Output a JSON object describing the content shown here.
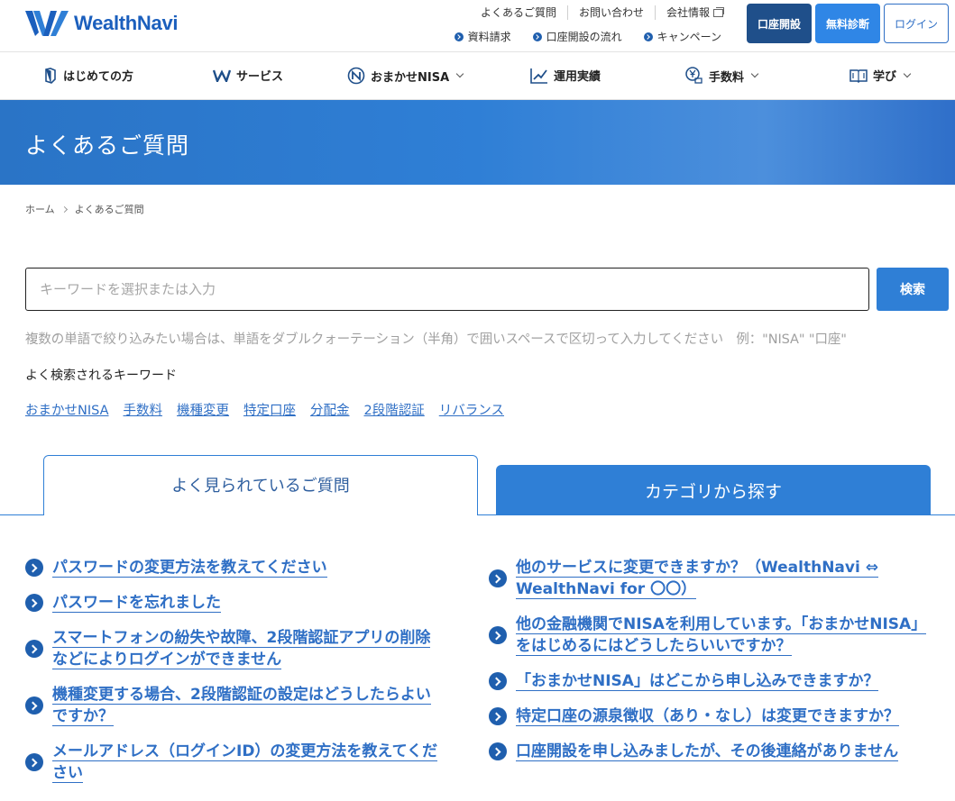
{
  "header": {
    "logo_text": "WealthNavi",
    "util_links": [
      "よくあるご質問",
      "お問い合わせ",
      "会社情報"
    ],
    "util_links2": [
      "資料請求",
      "口座開設の流れ",
      "キャンペーン"
    ],
    "btn_open": "口座開設",
    "btn_diagnosis": "無料診断",
    "btn_login": "ログイン",
    "brand_color": "#1b5fbd"
  },
  "nav": {
    "items": [
      "はじめての方",
      "サービス",
      "おまかせNISA",
      "運用実績",
      "手数料",
      "学び"
    ]
  },
  "hero": {
    "title": "よくあるご質問"
  },
  "breadcrumb": {
    "home": "ホーム",
    "current": "よくあるご質問"
  },
  "search": {
    "placeholder": "キーワードを選択または入力",
    "button": "検索",
    "hint": "複数の単語で絞り込みたい場合は、単語をダブルクォーテーション（半角）で囲いスペースで区切って入力してください　例：\"NISA\" \"口座\""
  },
  "keywords": {
    "title": "よく検索されるキーワード",
    "items": [
      "おまかせNISA",
      "手数料",
      "機種変更",
      "特定口座",
      "分配金",
      "2段階認証",
      "リバランス"
    ]
  },
  "tabs": {
    "active": "よく見られているご質問",
    "inactive": "カテゴリから探す"
  },
  "faq": {
    "left": [
      "パスワードの変更方法を教えてください",
      "パスワードを忘れました",
      "スマートフォンの紛失や故障、2段階認証アプリの削除などによりログインができません",
      "機種変更する場合、2段階認証の設定はどうしたらよいですか？",
      "メールアドレス（ログインID）の変更方法を教えてください"
    ],
    "right": [
      "他のサービスに変更できますか？（WealthNavi ⇔ WealthNavi for 〇〇）",
      "他の金融機関でNISAを利用しています。「おまかせNISA」をはじめるにはどうしたらいいですか？",
      "「おまかせNISA」はどこから申し込みできますか？",
      "特定口座の源泉徴収（あり・なし）は変更できますか？",
      "口座開設を申し込みましたが、その後連絡がありません"
    ]
  }
}
